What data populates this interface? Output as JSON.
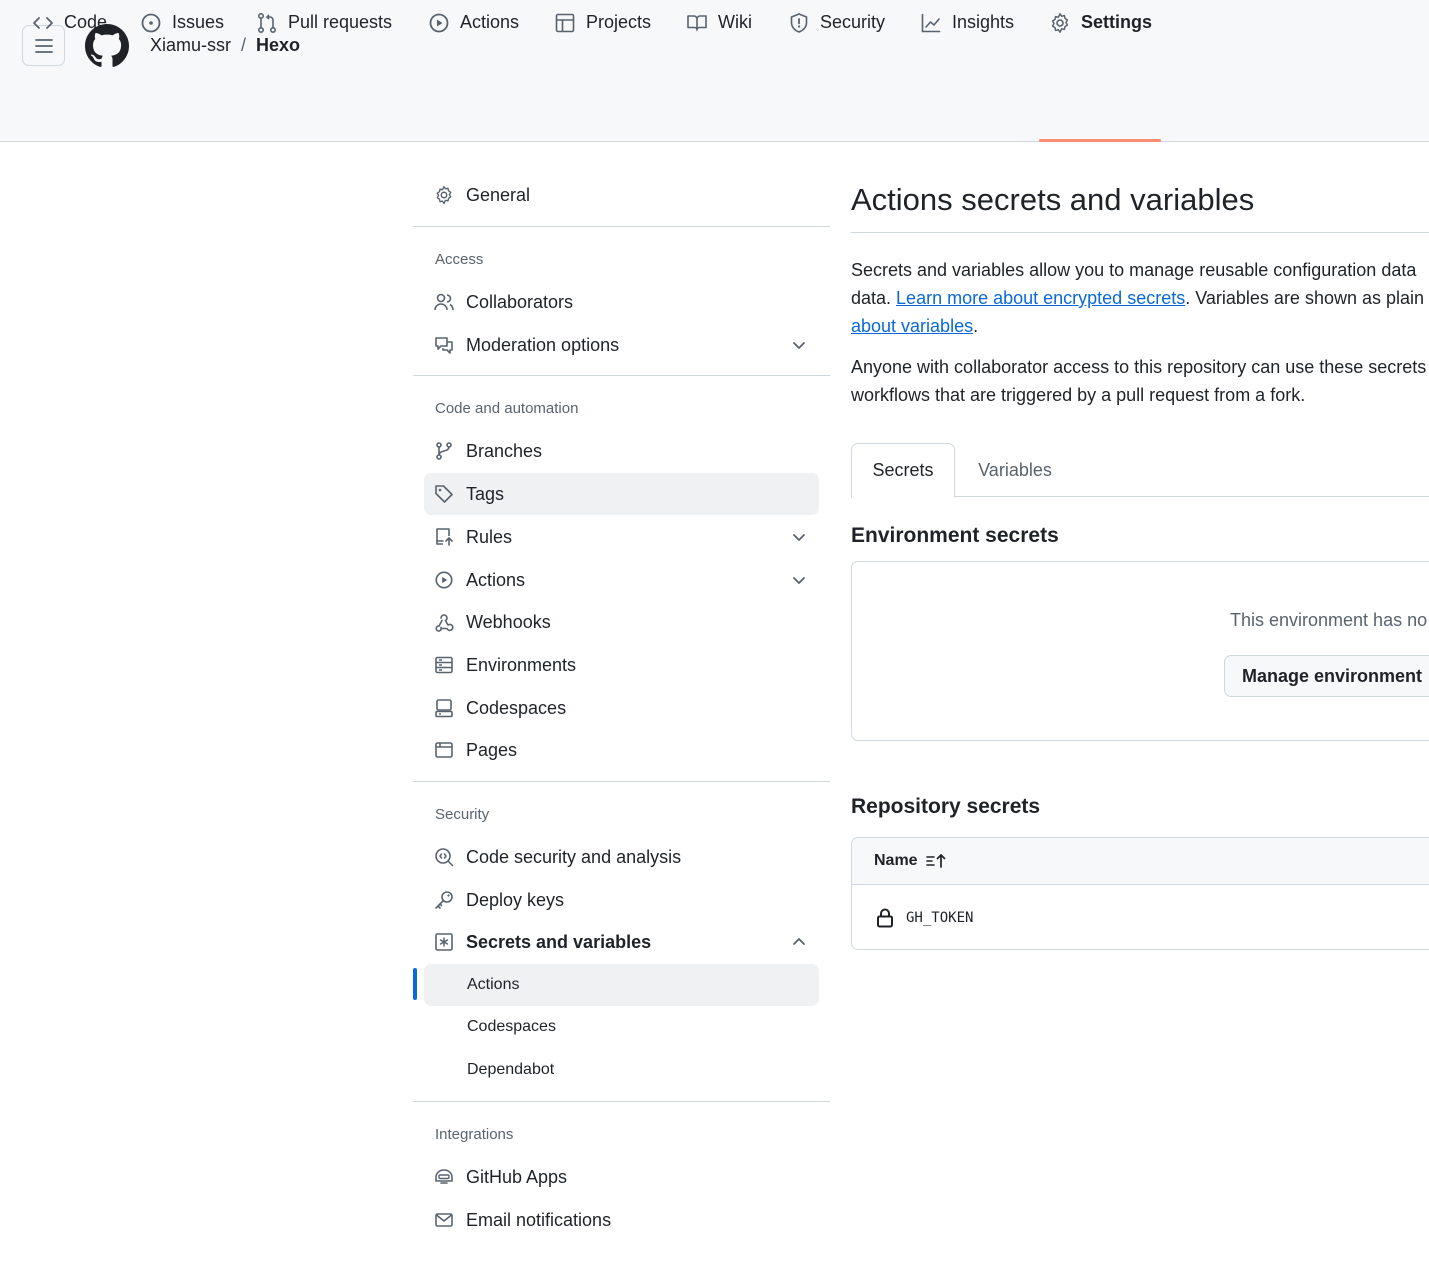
{
  "header": {
    "owner": "Xiamu-ssr",
    "separator": "/",
    "repo": "Hexo"
  },
  "tabs": [
    {
      "label": "Code",
      "icon": "code-icon"
    },
    {
      "label": "Issues",
      "icon": "issue-opened-icon"
    },
    {
      "label": "Pull requests",
      "icon": "git-pull-request-icon"
    },
    {
      "label": "Actions",
      "icon": "play-icon"
    },
    {
      "label": "Projects",
      "icon": "table-icon"
    },
    {
      "label": "Wiki",
      "icon": "book-icon"
    },
    {
      "label": "Security",
      "icon": "shield-icon"
    },
    {
      "label": "Insights",
      "icon": "graph-icon"
    },
    {
      "label": "Settings",
      "icon": "gear-icon",
      "active": true
    }
  ],
  "sidebar": {
    "general": "General",
    "access_heading": "Access",
    "collaborators": "Collaborators",
    "moderation": "Moderation options",
    "code_heading": "Code and automation",
    "branches": "Branches",
    "tags": "Tags",
    "rules": "Rules",
    "actions": "Actions",
    "webhooks": "Webhooks",
    "environments": "Environments",
    "codespaces": "Codespaces",
    "pages": "Pages",
    "security_heading": "Security",
    "code_security": "Code security and analysis",
    "deploy_keys": "Deploy keys",
    "secrets": "Secrets and variables",
    "sub_actions": "Actions",
    "sub_codespaces": "Codespaces",
    "sub_dependabot": "Dependabot",
    "integrations_heading": "Integrations",
    "github_apps": "GitHub Apps",
    "email_notifications": "Email notifications"
  },
  "main": {
    "title": "Actions secrets and variables",
    "para1_line1": "Secrets and variables allow you to manage reusable configuration data",
    "para1_line2_pre": "data. ",
    "para1_link1": "Learn more about encrypted secrets",
    "para1_line2_post": ". Variables are shown as plain",
    "para1_link2": "about variables",
    "para1_end": ".",
    "para2_line1": "Anyone with collaborator access to this repository can use these secrets",
    "para2_line2": "workflows that are triggered by a pull request from a fork.",
    "tab_secrets": "Secrets",
    "tab_variables": "Variables",
    "env_heading": "Environment secrets",
    "env_empty": "This environment has no",
    "env_button": "Manage environment",
    "repo_heading": "Repository secrets",
    "col_name": "Name",
    "secret_name": "GH_TOKEN"
  },
  "colors": {
    "accent": "#0969da",
    "tab_underline": "#fd8c73",
    "muted": "#59636e",
    "border": "#d0d7de"
  }
}
